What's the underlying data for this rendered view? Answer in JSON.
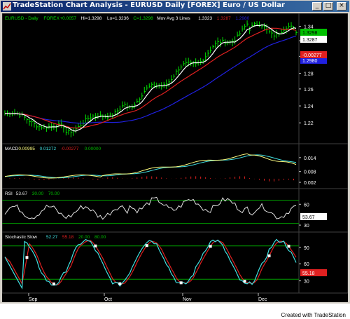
{
  "window": {
    "title": "TradeStation Chart Analysis - EURUSD  Daily  [FOREX] Euro / US Dollar",
    "footer": "Created with TradeStation"
  },
  "colors": {
    "price": "#00e000",
    "avg_fast": "#ffffff",
    "avg_mid": "#e02020",
    "avg_slow": "#2020e0",
    "macd": "#ffff80",
    "signal": "#40e0e0",
    "hist": "#e02020",
    "rsi": "#e0e0e0",
    "stoch_k": "#40e0e0",
    "stoch_d": "#e02020",
    "guide": "#00a000",
    "panel_border": "#404040"
  },
  "panels": {
    "price": {
      "header": [
        {
          "text": "EURUSD - Daily",
          "color": "#00e000"
        },
        {
          "text": "FOREX",
          "color": "#00e000"
        },
        {
          "text": "+0.0057",
          "color": "#00e000"
        },
        {
          "text": "Hi=1.3298",
          "color": "#ffffff"
        },
        {
          "text": "Lo=1.3236",
          "color": "#ffffff"
        },
        {
          "text": "C=1.3298",
          "color": "#00e000"
        },
        {
          "text": "Mov Avg 3 Lines",
          "color": "#ffffff"
        },
        {
          "text": "1.3323",
          "color": "#ffffff"
        },
        {
          "text": "1.3287",
          "color": "#e02020"
        },
        {
          "text": "1.2980",
          "color": "#2020e0"
        }
      ],
      "ticks": [
        "1.34",
        "1.32",
        "1.30",
        "1.28",
        "1.26",
        "1.24",
        "1.22"
      ],
      "badges": [
        {
          "text": "1.3298",
          "bg": "#00c000",
          "color": "#000000"
        },
        {
          "text": "1.3287",
          "bg": "#ffffff",
          "color": "#000000"
        },
        {
          "text": "1.2980",
          "bg": "#2020e0",
          "color": "#ffffff"
        }
      ]
    },
    "macd": {
      "header": [
        {
          "text": "MACD",
          "color": "#ffffff"
        },
        {
          "text": "0.00995",
          "color": "#ffff80"
        },
        {
          "text": "0.01272",
          "color": "#40e0e0"
        },
        {
          "text": "-0.00277",
          "color": "#e02020"
        },
        {
          "text": "0.00000",
          "color": "#00c000"
        }
      ],
      "ticks": [
        "0.014",
        "0.008",
        "0.002"
      ],
      "badges": [
        {
          "text": "-0.00277",
          "bg": "#e02020",
          "color": "#ffffff"
        }
      ]
    },
    "rsi": {
      "header": [
        {
          "text": "RSI",
          "color": "#ffffff"
        },
        {
          "text": "53.67",
          "color": "#e0e0e0"
        },
        {
          "text": "30.00",
          "color": "#00c000"
        },
        {
          "text": "70.00",
          "color": "#00c000"
        }
      ],
      "ticks": [
        "60",
        "30"
      ],
      "badges": [
        {
          "text": "53.67",
          "bg": "#ffffff",
          "color": "#000000"
        }
      ]
    },
    "stoch": {
      "header": [
        {
          "text": "Stochastic Slow",
          "color": "#ffffff"
        },
        {
          "text": "52.27",
          "color": "#40e0e0"
        },
        {
          "text": "55.18",
          "color": "#e02020"
        },
        {
          "text": "20.00",
          "color": "#00c000"
        },
        {
          "text": "80.00",
          "color": "#00c000"
        }
      ],
      "ticks": [
        "90",
        "60",
        "30"
      ],
      "badges": [
        {
          "text": "55.18",
          "bg": "#e02020",
          "color": "#ffffff"
        }
      ]
    }
  },
  "xaxis": [
    "Sep",
    "Oct",
    "Nov",
    "Dec"
  ]
}
